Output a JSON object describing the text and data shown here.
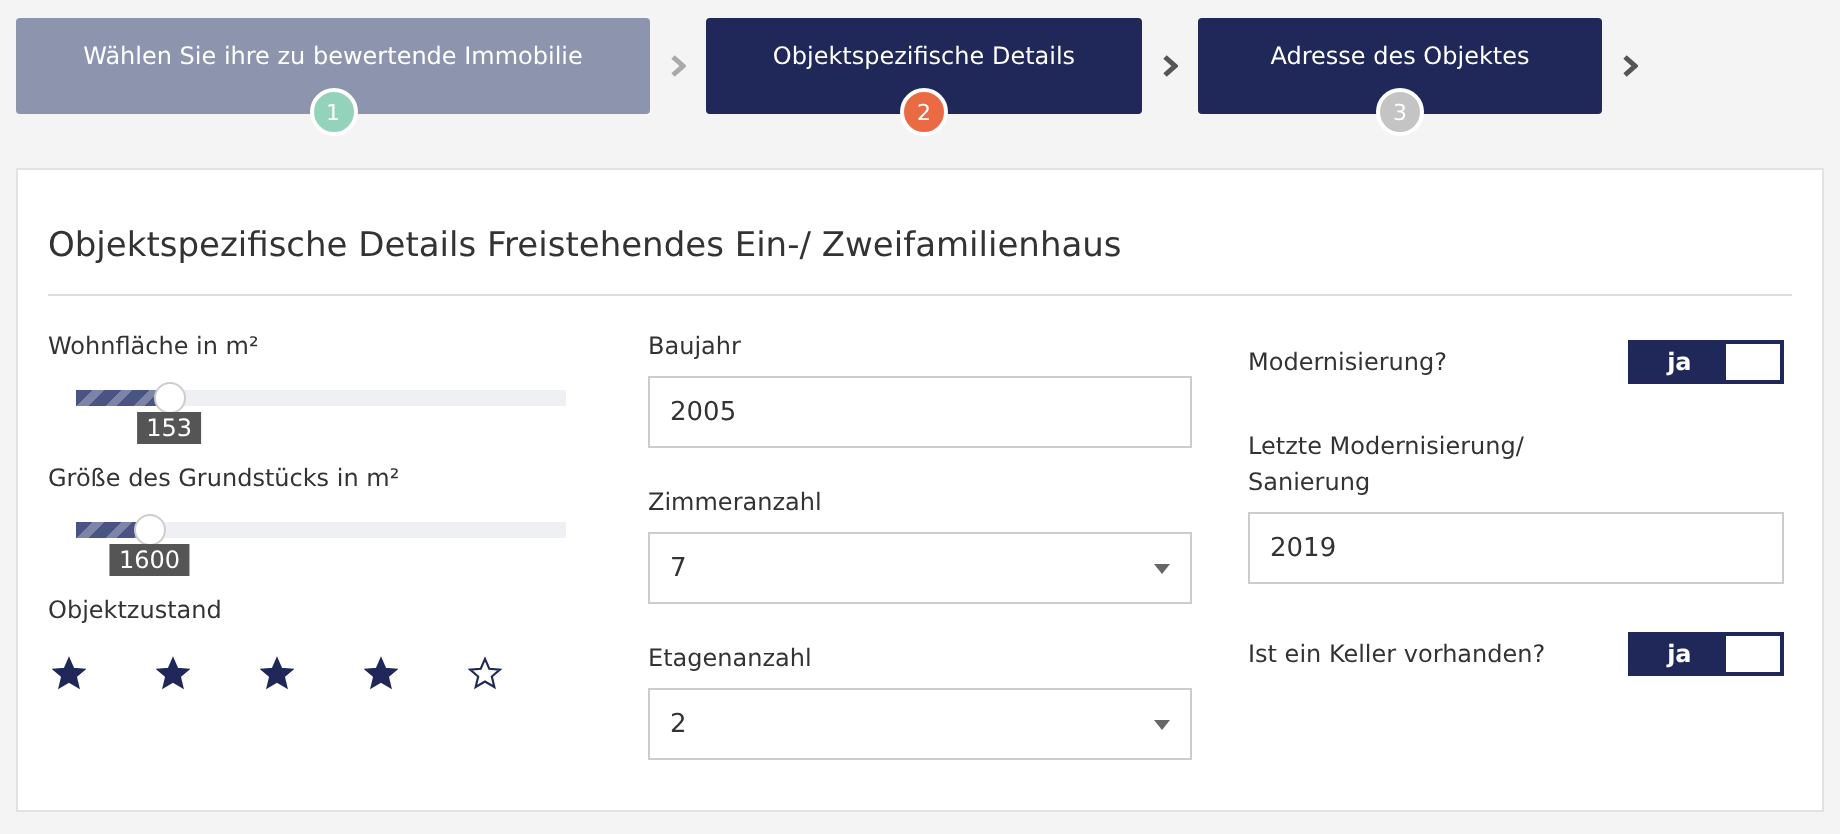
{
  "steps": [
    {
      "label": "Wählen Sie ihre zu bewertende Immobilie",
      "number": "1",
      "done": true,
      "selected": false
    },
    {
      "label": "Objektspezifische Details",
      "number": "2",
      "done": false,
      "selected": true
    },
    {
      "label": "Adresse des Objektes",
      "number": "3",
      "done": false,
      "selected": false
    }
  ],
  "form": {
    "title": "Objektspezifische Details Freistehendes Ein-/ Zweifamilienhaus",
    "columns": [
      [
        {
          "kind": "slider",
          "label": "Wohnfläche in m²",
          "level": 0.19,
          "reading": "153"
        },
        {
          "kind": "slider",
          "label": "Größe des Grundstücks in m²",
          "level": 0.15,
          "reading": "1600"
        },
        {
          "kind": "stars",
          "label": "Objektzustand",
          "stars": 4
        }
      ],
      [
        {
          "kind": "input",
          "label": "Baujahr",
          "value": "2005"
        },
        {
          "kind": "select",
          "label": "Zimmeranzahl",
          "value": "7"
        },
        {
          "kind": "select",
          "label": "Etagenanzahl",
          "value": "2"
        }
      ],
      [
        {
          "kind": "toggle",
          "label": "Modernisierung?",
          "on": true,
          "text": "ja"
        },
        {
          "kind": "input",
          "label": "Letzte Modernisierung/\n Sanierung",
          "value": "2019"
        },
        {
          "kind": "toggle",
          "label": "Ist ein Keller vorhanden?",
          "on": true,
          "text": "ja"
        }
      ]
    ]
  }
}
